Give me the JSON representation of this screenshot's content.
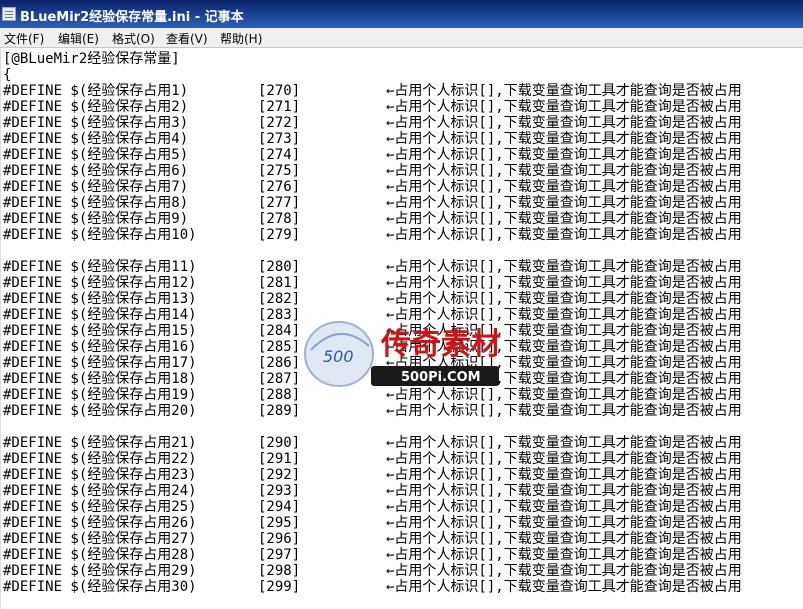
{
  "window": {
    "title": "BLueMir2经验保存常量.ini - 记事本",
    "app_icon": "notepad-icon"
  },
  "menu": [
    {
      "label": "文件(F)"
    },
    {
      "label": "编辑(E)"
    },
    {
      "label": "格式(O)"
    },
    {
      "label": "查看(V)"
    },
    {
      "label": "帮助(H)"
    }
  ],
  "editor": {
    "header": "[@BLueMir2经验保存常量]",
    "open_brace": "{",
    "comment": "←占用个人标识[],下载变量查询工具才能查询是否被占用",
    "groups": [
      {
        "rows": [
          {
            "name": "#DEFINE $(经验保存占用1)",
            "value": "[270]"
          },
          {
            "name": "#DEFINE $(经验保存占用2)",
            "value": "[271]"
          },
          {
            "name": "#DEFINE $(经验保存占用3)",
            "value": "[272]"
          },
          {
            "name": "#DEFINE $(经验保存占用4)",
            "value": "[273]"
          },
          {
            "name": "#DEFINE $(经验保存占用5)",
            "value": "[274]"
          },
          {
            "name": "#DEFINE $(经验保存占用6)",
            "value": "[275]"
          },
          {
            "name": "#DEFINE $(经验保存占用7)",
            "value": "[276]"
          },
          {
            "name": "#DEFINE $(经验保存占用8)",
            "value": "[277]"
          },
          {
            "name": "#DEFINE $(经验保存占用9)",
            "value": "[278]"
          },
          {
            "name": "#DEFINE $(经验保存占用10)",
            "value": "[279]"
          }
        ]
      },
      {
        "rows": [
          {
            "name": "#DEFINE $(经验保存占用11)",
            "value": "[280]"
          },
          {
            "name": "#DEFINE $(经验保存占用12)",
            "value": "[281]"
          },
          {
            "name": "#DEFINE $(经验保存占用13)",
            "value": "[282]"
          },
          {
            "name": "#DEFINE $(经验保存占用14)",
            "value": "[283]"
          },
          {
            "name": "#DEFINE $(经验保存占用15)",
            "value": "[284]"
          },
          {
            "name": "#DEFINE $(经验保存占用16)",
            "value": "[285]"
          },
          {
            "name": "#DEFINE $(经验保存占用17)",
            "value": "[286]"
          },
          {
            "name": "#DEFINE $(经验保存占用18)",
            "value": "[287]"
          },
          {
            "name": "#DEFINE $(经验保存占用19)",
            "value": "[288]"
          },
          {
            "name": "#DEFINE $(经验保存占用20)",
            "value": "[289]"
          }
        ]
      },
      {
        "rows": [
          {
            "name": "#DEFINE $(经验保存占用21)",
            "value": "[290]"
          },
          {
            "name": "#DEFINE $(经验保存占用22)",
            "value": "[291]"
          },
          {
            "name": "#DEFINE $(经验保存占用23)",
            "value": "[292]"
          },
          {
            "name": "#DEFINE $(经验保存占用24)",
            "value": "[293]"
          },
          {
            "name": "#DEFINE $(经验保存占用25)",
            "value": "[294]"
          },
          {
            "name": "#DEFINE $(经验保存占用26)",
            "value": "[295]"
          },
          {
            "name": "#DEFINE $(经验保存占用27)",
            "value": "[296]"
          },
          {
            "name": "#DEFINE $(经验保存占用28)",
            "value": "[297]"
          },
          {
            "name": "#DEFINE $(经验保存占用29)",
            "value": "[298]"
          },
          {
            "name": "#DEFINE $(经验保存占用30)",
            "value": "[299]"
          }
        ]
      }
    ]
  },
  "watermark": {
    "icon": "500pi-logo",
    "brand_text": "传奇素材",
    "site_text": "500Pi.COM",
    "badge_text": "500"
  }
}
